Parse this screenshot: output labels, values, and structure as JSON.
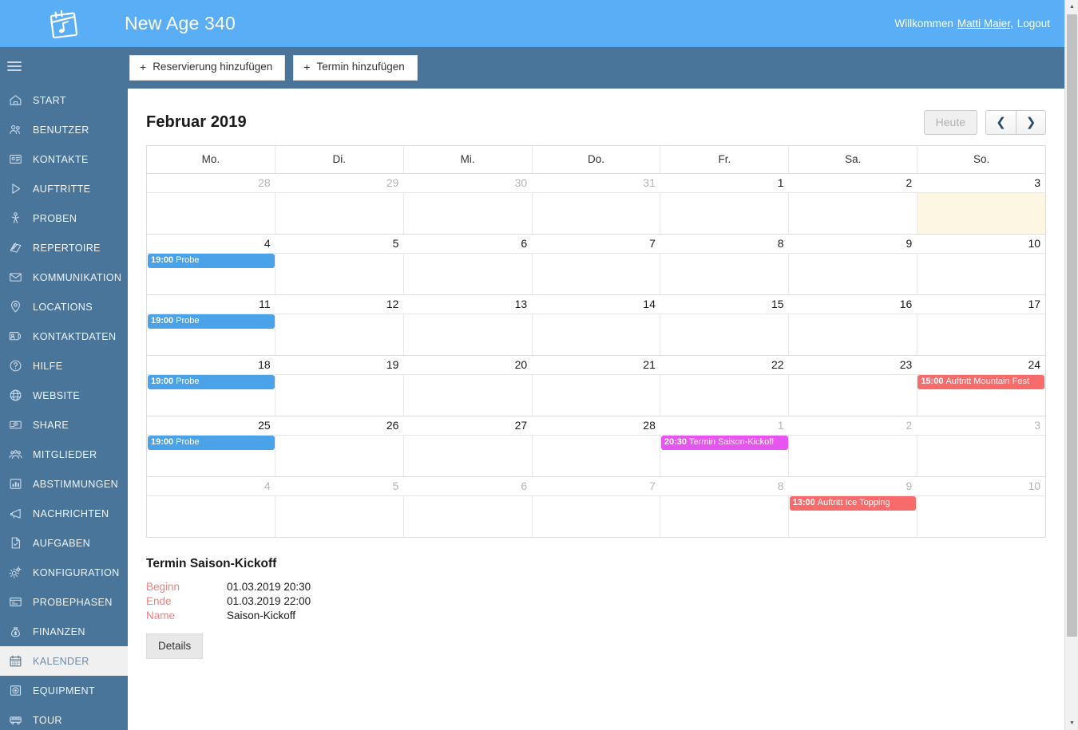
{
  "topbar": {
    "app_title": "New Age 340",
    "logo_icon": "calendar-music-icon",
    "welcome_text": "Willkommen",
    "user_name": "Matti Maier,",
    "logout_label": "Logout"
  },
  "sidebar": {
    "menu_icon": "hamburger-icon",
    "items": [
      {
        "label": "START",
        "icon": "home-icon",
        "active": false
      },
      {
        "label": "BENUTZER",
        "icon": "users-icon",
        "active": false
      },
      {
        "label": "KONTAKTE",
        "icon": "id-card-icon",
        "active": false
      },
      {
        "label": "AUFTRITTE",
        "icon": "play-triangle-icon",
        "active": false
      },
      {
        "label": "PROBEN",
        "icon": "microphone-stand-icon",
        "active": false
      },
      {
        "label": "REPERTOIRE",
        "icon": "books-icon",
        "active": false
      },
      {
        "label": "KOMMUNIKATION",
        "icon": "envelope-icon",
        "active": false
      },
      {
        "label": "LOCATIONS",
        "icon": "map-pin-icon",
        "active": false
      },
      {
        "label": "KONTAKTDATEN",
        "icon": "contact-card-icon",
        "active": false
      },
      {
        "label": "HILFE",
        "icon": "question-circle-icon",
        "active": false
      },
      {
        "label": "WEBSITE",
        "icon": "globe-icon",
        "active": false
      },
      {
        "label": "SHARE",
        "icon": "share-box-icon",
        "active": false
      },
      {
        "label": "MITGLIEDER",
        "icon": "group-icon",
        "active": false
      },
      {
        "label": "ABSTIMMUNGEN",
        "icon": "bar-chart-icon",
        "active": false
      },
      {
        "label": "NACHRICHTEN",
        "icon": "megaphone-icon",
        "active": false
      },
      {
        "label": "AUFGABEN",
        "icon": "task-page-icon",
        "active": false
      },
      {
        "label": "KONFIGURATION",
        "icon": "gears-icon",
        "active": false
      },
      {
        "label": "PROBEPHASEN",
        "icon": "window-icon",
        "active": false
      },
      {
        "label": "FINANZEN",
        "icon": "money-bag-icon",
        "active": false
      },
      {
        "label": "KALENDER",
        "icon": "calendar-icon",
        "active": true
      },
      {
        "label": "EQUIPMENT",
        "icon": "speaker-icon",
        "active": false
      },
      {
        "label": "TOUR",
        "icon": "bus-icon",
        "active": false
      }
    ]
  },
  "action_bar": {
    "buttons": [
      {
        "label": "Reservierung hinzufügen",
        "icon": "plus-icon"
      },
      {
        "label": "Termin hinzufügen",
        "icon": "plus-icon"
      }
    ]
  },
  "calendar": {
    "title": "Februar 2019",
    "today_label": "Heute",
    "prev_icon": "chevron-left-icon",
    "next_icon": "chevron-right-icon",
    "day_headers": [
      "Mo.",
      "Di.",
      "Mi.",
      "Do.",
      "Fr.",
      "Sa.",
      "So."
    ],
    "colors": {
      "probe": "#4aa3e8",
      "auftritt": "#f76b6b",
      "termin": "#e855ee",
      "today_cell": "#fdf6e3"
    },
    "weeks": [
      {
        "dates": [
          {
            "n": "28",
            "other": true
          },
          {
            "n": "29",
            "other": true
          },
          {
            "n": "30",
            "other": true
          },
          {
            "n": "31",
            "other": true
          },
          {
            "n": "1",
            "other": false
          },
          {
            "n": "2",
            "other": false
          },
          {
            "n": "3",
            "other": false
          }
        ],
        "today_col": 6,
        "events": []
      },
      {
        "dates": [
          {
            "n": "4",
            "other": false
          },
          {
            "n": "5",
            "other": false
          },
          {
            "n": "6",
            "other": false
          },
          {
            "n": "7",
            "other": false
          },
          {
            "n": "8",
            "other": false
          },
          {
            "n": "9",
            "other": false
          },
          {
            "n": "10",
            "other": false
          }
        ],
        "today_col": -1,
        "events": [
          {
            "col": 0,
            "time": "19:00",
            "title": "Probe",
            "type": "probe"
          }
        ]
      },
      {
        "dates": [
          {
            "n": "11",
            "other": false
          },
          {
            "n": "12",
            "other": false
          },
          {
            "n": "13",
            "other": false
          },
          {
            "n": "14",
            "other": false
          },
          {
            "n": "15",
            "other": false
          },
          {
            "n": "16",
            "other": false
          },
          {
            "n": "17",
            "other": false
          }
        ],
        "today_col": -1,
        "events": [
          {
            "col": 0,
            "time": "19:00",
            "title": "Probe",
            "type": "probe"
          }
        ]
      },
      {
        "dates": [
          {
            "n": "18",
            "other": false
          },
          {
            "n": "19",
            "other": false
          },
          {
            "n": "20",
            "other": false
          },
          {
            "n": "21",
            "other": false
          },
          {
            "n": "22",
            "other": false
          },
          {
            "n": "23",
            "other": false
          },
          {
            "n": "24",
            "other": false
          }
        ],
        "today_col": -1,
        "events": [
          {
            "col": 0,
            "time": "19:00",
            "title": "Probe",
            "type": "probe"
          },
          {
            "col": 6,
            "time": "15:00",
            "title": "Auftritt Mountain Fest",
            "type": "auftritt"
          }
        ]
      },
      {
        "dates": [
          {
            "n": "25",
            "other": false
          },
          {
            "n": "26",
            "other": false
          },
          {
            "n": "27",
            "other": false
          },
          {
            "n": "28",
            "other": false
          },
          {
            "n": "1",
            "other": true
          },
          {
            "n": "2",
            "other": true
          },
          {
            "n": "3",
            "other": true
          }
        ],
        "today_col": -1,
        "events": [
          {
            "col": 0,
            "time": "19:00",
            "title": "Probe",
            "type": "probe"
          },
          {
            "col": 4,
            "time": "20:30",
            "title": "Termin Saison-Kickoff",
            "type": "termin"
          }
        ]
      },
      {
        "dates": [
          {
            "n": "4",
            "other": true
          },
          {
            "n": "5",
            "other": true
          },
          {
            "n": "6",
            "other": true
          },
          {
            "n": "7",
            "other": true
          },
          {
            "n": "8",
            "other": true
          },
          {
            "n": "9",
            "other": true
          },
          {
            "n": "10",
            "other": true
          }
        ],
        "today_col": -1,
        "events": [
          {
            "col": 5,
            "time": "13:00",
            "title": "Auftritt Ice Topping",
            "type": "auftritt"
          }
        ]
      }
    ]
  },
  "detail": {
    "heading": "Termin Saison-Kickoff",
    "rows": [
      {
        "label": "Beginn",
        "value": "01.03.2019 20:30"
      },
      {
        "label": "Ende",
        "value": "01.03.2019 22:00"
      },
      {
        "label": "Name",
        "value": "Saison-Kickoff"
      }
    ],
    "details_button": "Details"
  }
}
